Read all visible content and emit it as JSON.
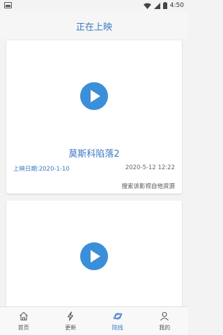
{
  "status_bar": {
    "time": "4:50"
  },
  "header": {
    "title": "正在上映"
  },
  "cards": [
    {
      "movie_title": "莫斯科陷落2",
      "release_label": "上映日期:2020-1-10",
      "updated": "2020-5-12 12:22",
      "search_text": "搜索该影视自他资源"
    },
    {
      "movie_title": ""
    }
  ],
  "tabs": [
    {
      "label": "首页",
      "icon": "home-icon"
    },
    {
      "label": "更新",
      "icon": "lightning-icon"
    },
    {
      "label": "院线",
      "icon": "planet-icon",
      "active": true
    },
    {
      "label": "我的",
      "icon": "user-icon"
    }
  ],
  "colors": {
    "accent": "#3a78c2",
    "play": "#3b8fd8"
  }
}
